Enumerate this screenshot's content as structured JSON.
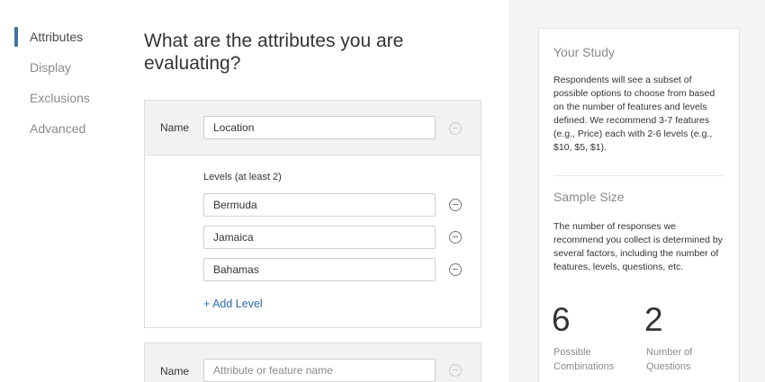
{
  "nav": {
    "items": [
      "Attributes",
      "Display",
      "Exclusions",
      "Advanced"
    ],
    "active": "Attributes"
  },
  "main": {
    "title": "What are the attributes you are evaluating?",
    "attributes": [
      {
        "name_label": "Name",
        "name_value": "Location",
        "levels_label": "Levels (at least 2)",
        "levels": [
          "Bermuda",
          "Jamaica",
          "Bahamas"
        ],
        "add_level": "+ Add Level"
      },
      {
        "name_label": "Name",
        "name_value": "",
        "name_placeholder": "Attribute or feature name"
      }
    ]
  },
  "study": {
    "title": "Your Study",
    "description": "Respondents will see a subset of possible options to choose from based on the number of features and levels defined. We recommend 3-7 features (e.g., Price) each with 2-6 levels (e.g., $10, $5, $1).",
    "sample_title": "Sample Size",
    "sample_description": "The number of responses we recommend you collect is determined by several factors, including the number of features, levels, questions, etc.",
    "stats": [
      {
        "value": "6",
        "label": "Possible Combinations"
      },
      {
        "value": "2",
        "label": "Number of Questions"
      }
    ]
  },
  "colors": {
    "accent": "#3b74a8",
    "link": "#2b6fb0",
    "panel_bg": "#f4f4f4"
  }
}
